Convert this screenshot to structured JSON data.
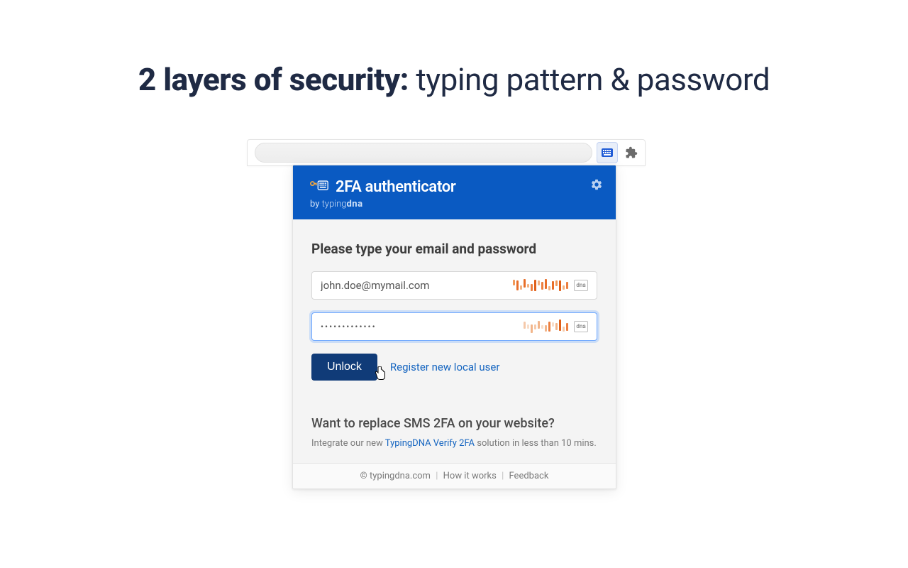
{
  "headline": {
    "bold": "2 layers of security:",
    "rest": " typing pattern & password"
  },
  "extension_icon_name": "typingdna-extension-icon",
  "popup": {
    "title": "2FA authenticator",
    "by_prefix": "by ",
    "brand_a": "typing",
    "brand_b": "dna",
    "prompt": "Please type your email and password",
    "email_value": "john.doe@mymail.com",
    "password_value": "•••••••••••••",
    "dna_badge": "dna",
    "unlock_label": "Unlock",
    "register_label": "Register new local user",
    "promo_heading": "Want to replace SMS 2FA on your website?",
    "promo_text_before": "Integrate our new ",
    "promo_link": "TypingDNA Verify 2FA",
    "promo_text_after": " solution in less than 10 mins.",
    "footer_copyright": "© typingdna.com",
    "footer_how": "How it works",
    "footer_feedback": "Feedback"
  },
  "colors": {
    "header_bg": "#0a5ac2",
    "unlock_bg": "#103b78",
    "link": "#1565c0"
  }
}
